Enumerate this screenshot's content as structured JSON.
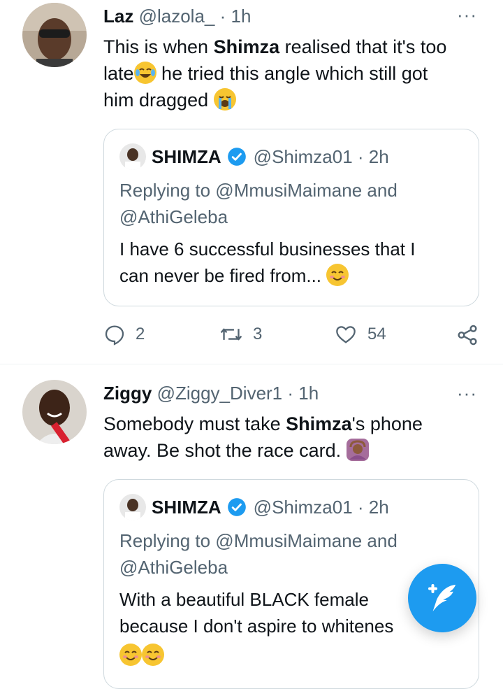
{
  "tweets": [
    {
      "author": "Laz",
      "handle": "@lazola_",
      "time": "· 1h",
      "more": "···",
      "text_parts": [
        "This is when ",
        "Shimza",
        " realised that it's too",
        "late",
        " he tried this angle which still got",
        "him dragged"
      ],
      "avatar_icon": "avatar-photo-icon",
      "quote": {
        "author": "SHIMZA",
        "handle_time": "@Shimza01 · 2h",
        "reply_line1": "Replying to @MmusiMaimane and",
        "reply_line2": "@AthiGeleba",
        "text_line1": "I have 6 successful businesses that I",
        "text_line2": "can never be fired from..."
      },
      "actions": {
        "replies": "2",
        "retweets": "3",
        "likes": "54"
      }
    },
    {
      "author": "Ziggy",
      "handle": "@Ziggy_Diver1",
      "time": "· 1h",
      "more": "···",
      "text_parts": [
        "Somebody must take ",
        "Shimza",
        "'s phone",
        "away. Be shot the race card."
      ],
      "avatar_icon": "avatar-photo-icon",
      "quote": {
        "author": "SHIMZA",
        "handle_time": "@Shimza01 · 2h",
        "reply_line1": "Replying to @MmusiMaimane and",
        "reply_line2": "@AthiGeleba",
        "text_line1": "With a beautiful BLACK female",
        "text_line2": "because I don't aspire to whitenes"
      }
    }
  ],
  "colors": {
    "accent": "#1d9bf0",
    "text": "#0f1419",
    "muted": "#536471",
    "border": "#cfd9de"
  },
  "compose_button": {
    "icon": "compose-tweet-icon"
  }
}
